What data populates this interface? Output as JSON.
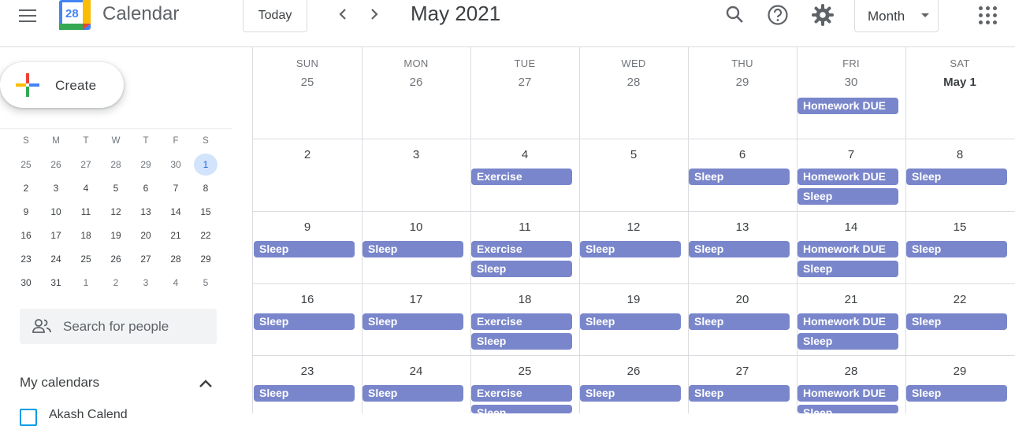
{
  "header": {
    "app_title": "Calendar",
    "logo_day": "28",
    "today_label": "Today",
    "month_title": "May 2021",
    "view_label": "Month"
  },
  "sidebar": {
    "create_label": "Create",
    "mini_calendar": {
      "weekdays": [
        "S",
        "M",
        "T",
        "W",
        "T",
        "F",
        "S"
      ],
      "weeks": [
        [
          "25",
          "26",
          "27",
          "28",
          "29",
          "30",
          "1"
        ],
        [
          "2",
          "3",
          "4",
          "5",
          "6",
          "7",
          "8"
        ],
        [
          "9",
          "10",
          "11",
          "12",
          "13",
          "14",
          "15"
        ],
        [
          "16",
          "17",
          "18",
          "19",
          "20",
          "21",
          "22"
        ],
        [
          "23",
          "24",
          "25",
          "26",
          "27",
          "28",
          "29"
        ],
        [
          "30",
          "31",
          "1",
          "2",
          "3",
          "4",
          "5"
        ]
      ]
    },
    "search_people_placeholder": "Search for people",
    "my_calendars_label": "My calendars",
    "calendar_item_label": "Akash Calend"
  },
  "grid": {
    "weekday_headers": [
      "SUN",
      "MON",
      "TUE",
      "WED",
      "THU",
      "FRI",
      "SAT"
    ],
    "weeks": [
      {
        "days": [
          "25",
          "26",
          "27",
          "28",
          "29",
          "30",
          "May 1"
        ],
        "events": [
          [],
          [],
          [],
          [],
          [],
          [
            "Homework DUE"
          ],
          []
        ]
      },
      {
        "days": [
          "2",
          "3",
          "4",
          "5",
          "6",
          "7",
          "8"
        ],
        "events": [
          [],
          [],
          [
            "Exercise"
          ],
          [],
          [
            "Sleep"
          ],
          [
            "Homework DUE",
            "Sleep"
          ],
          [
            "Sleep"
          ]
        ]
      },
      {
        "days": [
          "9",
          "10",
          "11",
          "12",
          "13",
          "14",
          "15"
        ],
        "events": [
          [
            "Sleep"
          ],
          [
            "Sleep"
          ],
          [
            "Exercise",
            "Sleep"
          ],
          [
            "Sleep"
          ],
          [
            "Sleep"
          ],
          [
            "Homework DUE",
            "Sleep"
          ],
          [
            "Sleep"
          ]
        ]
      },
      {
        "days": [
          "16",
          "17",
          "18",
          "19",
          "20",
          "21",
          "22"
        ],
        "events": [
          [
            "Sleep"
          ],
          [
            "Sleep"
          ],
          [
            "Exercise",
            "Sleep"
          ],
          [
            "Sleep"
          ],
          [
            "Sleep"
          ],
          [
            "Homework DUE",
            "Sleep"
          ],
          [
            "Sleep"
          ]
        ]
      },
      {
        "days": [
          "23",
          "24",
          "25",
          "26",
          "27",
          "28",
          "29"
        ],
        "events": [
          [
            "Sleep"
          ],
          [
            "Sleep"
          ],
          [
            "Exercise",
            "Sleep"
          ],
          [
            "Sleep"
          ],
          [
            "Sleep"
          ],
          [
            "Homework DUE",
            "Sleep"
          ],
          [
            "Sleep"
          ]
        ]
      }
    ]
  },
  "colors": {
    "event": "#7986cb",
    "selected_day_bg": "#d2e3fc"
  }
}
